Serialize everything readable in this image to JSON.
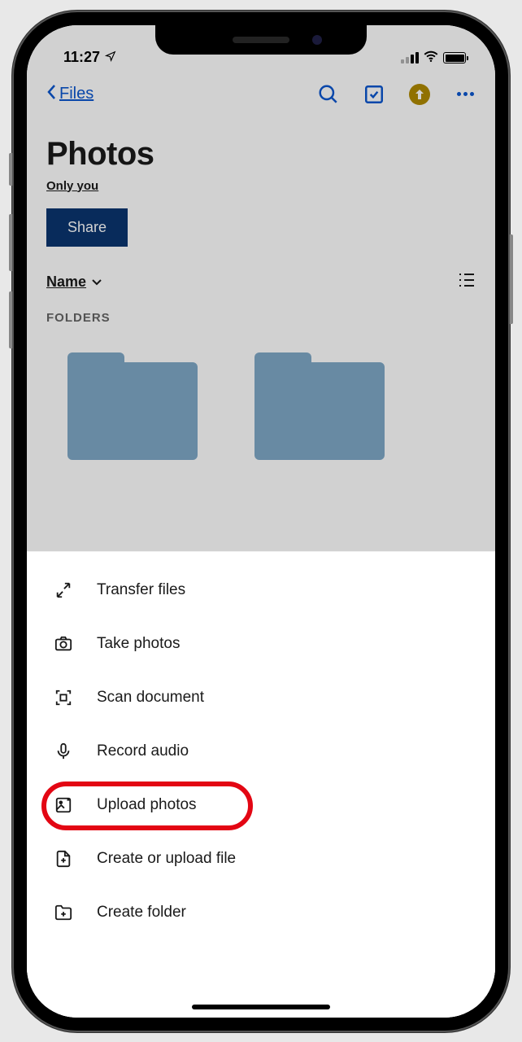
{
  "status": {
    "time": "11:27"
  },
  "nav": {
    "back_label": "Files"
  },
  "page": {
    "title": "Photos",
    "visibility": "Only you",
    "share_label": "Share",
    "sort_label": "Name",
    "section_header": "FOLDERS"
  },
  "actions": [
    {
      "icon": "transfer-icon",
      "label": "Transfer files",
      "highlighted": false
    },
    {
      "icon": "camera-icon",
      "label": "Take photos",
      "highlighted": false
    },
    {
      "icon": "scan-icon",
      "label": "Scan document",
      "highlighted": false
    },
    {
      "icon": "mic-icon",
      "label": "Record audio",
      "highlighted": false
    },
    {
      "icon": "image-upload-icon",
      "label": "Upload photos",
      "highlighted": true
    },
    {
      "icon": "file-plus-icon",
      "label": "Create or upload file",
      "highlighted": false
    },
    {
      "icon": "folder-plus-icon",
      "label": "Create folder",
      "highlighted": false
    }
  ]
}
